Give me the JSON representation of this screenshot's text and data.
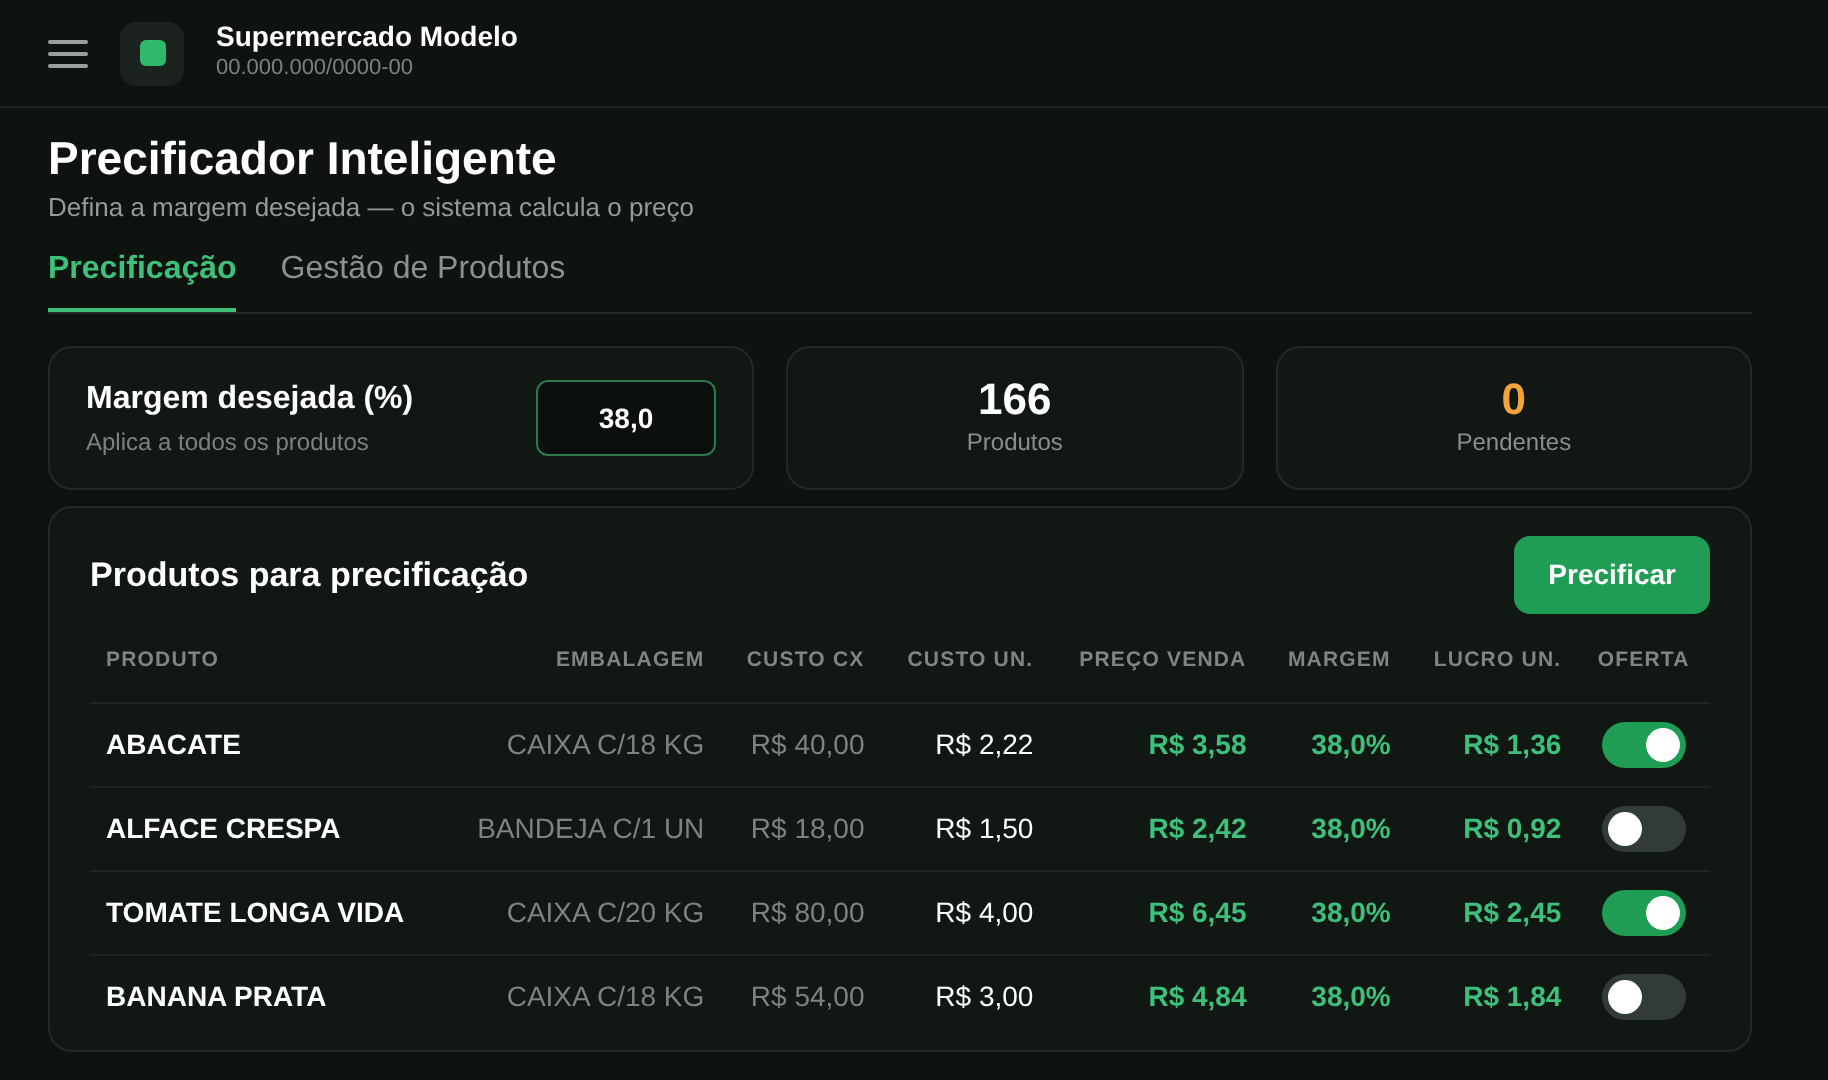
{
  "header": {
    "store_name": "Supermercado Modelo",
    "store_id": "00.000.000/0000-00"
  },
  "page": {
    "title": "Precificador Inteligente",
    "subtitle": "Defina a margem desejada — o sistema calcula o preço"
  },
  "tabs": [
    {
      "label": "Precificação",
      "selected": true
    },
    {
      "label": "Gestão de Produtos",
      "selected": false
    }
  ],
  "margin_card": {
    "label": "Margem desejada (%)",
    "hint": "Aplica a todos os produtos",
    "value": "38,0"
  },
  "stats": [
    {
      "value": "166",
      "label": "Produtos",
      "kind": "normal"
    },
    {
      "value": "0",
      "label": "Pendentes",
      "kind": "warning"
    }
  ],
  "products_panel": {
    "title": "Produtos para precificação",
    "button": "Precificar",
    "columns": [
      "PRODUTO",
      "EMBALAGEM",
      "CUSTO CX",
      "CUSTO UN.",
      "PREÇO VENDA",
      "MARGEM",
      "LUCRO UN.",
      "OFERTA"
    ],
    "rows": [
      {
        "produto": "ABACATE",
        "embalagem": "CAIXA C/18 KG",
        "custo_cx": "R$ 40,00",
        "custo_un": "R$ 2,22",
        "preco_venda": "R$ 3,58",
        "margem": "38,0%",
        "lucro_un": "R$ 1,36",
        "oferta": true
      },
      {
        "produto": "ALFACE CRESPA",
        "embalagem": "BANDEJA C/1 UN",
        "custo_cx": "R$ 18,00",
        "custo_un": "R$ 1,50",
        "preco_venda": "R$ 2,42",
        "margem": "38,0%",
        "lucro_un": "R$ 0,92",
        "oferta": false
      },
      {
        "produto": "TOMATE LONGA VIDA",
        "embalagem": "CAIXA C/20 KG",
        "custo_cx": "R$ 80,00",
        "custo_un": "R$ 4,00",
        "preco_venda": "R$ 6,45",
        "margem": "38,0%",
        "lucro_un": "R$ 2,45",
        "oferta": true
      },
      {
        "produto": "BANANA PRATA",
        "embalagem": "CAIXA C/18 KG",
        "custo_cx": "R$ 54,00",
        "custo_un": "R$ 3,00",
        "preco_venda": "R$ 4,84",
        "margem": "38,0%",
        "lucro_un": "R$ 1,84",
        "oferta": false
      }
    ]
  }
}
